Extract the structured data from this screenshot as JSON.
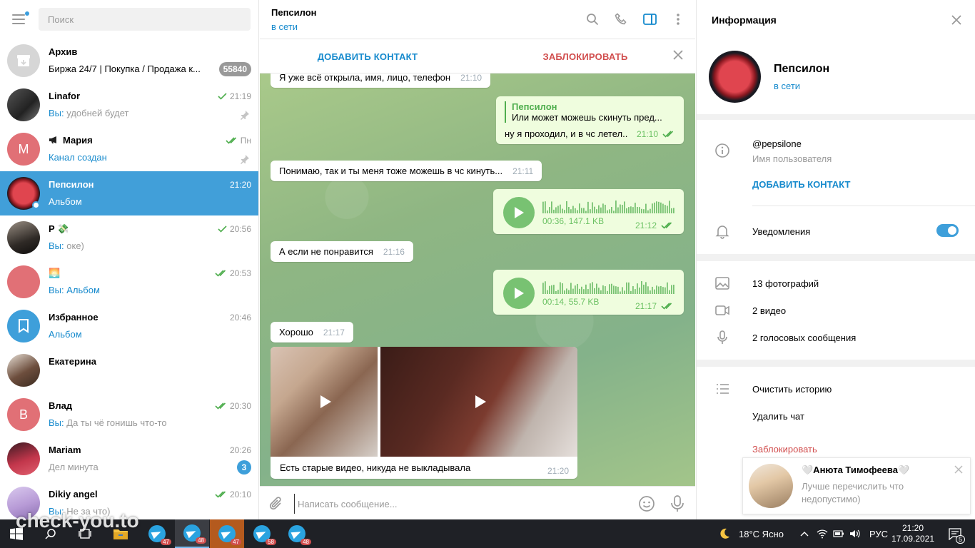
{
  "left": {
    "search_placeholder": "Поиск",
    "chats": [
      {
        "name": "Архив",
        "preview": "Биржа 24/7 | Покупка / Продажа к...",
        "badge": "55840"
      },
      {
        "name": "Linafor",
        "time": "21:19",
        "you": "Вы:",
        "preview": "удобней будет"
      },
      {
        "name": "Мария",
        "time": "Пн",
        "preview": "Канал создан",
        "initial": "М"
      },
      {
        "name": "Пепсилон",
        "time": "21:20",
        "preview": "Альбом"
      },
      {
        "name": "Р 💸",
        "time": "20:56",
        "you": "Вы:",
        "preview": "оке)"
      },
      {
        "name": "🌅",
        "time": "20:53",
        "you": "Вы:",
        "preview": "Альбом"
      },
      {
        "name": "Избранное",
        "time": "20:46",
        "preview": "Альбом"
      },
      {
        "name": "Екатерина",
        "time": "",
        "preview": ""
      },
      {
        "name": "Влад",
        "time": "20:30",
        "you": "Вы:",
        "preview": "Да ты чё гонишь что-то",
        "initial": "В"
      },
      {
        "name": "Mariam",
        "time": "20:26",
        "preview": "Дел минута",
        "badge": "3"
      },
      {
        "name": "Dikiy angel",
        "time": "20:10",
        "you": "Вы:",
        "preview": "Не за что)"
      }
    ]
  },
  "chat": {
    "peer_name": "Пепсилон",
    "peer_status": "в сети",
    "add_contact": "ДОБАВИТЬ КОНТАКТ",
    "block": "ЗАБЛОКИРОВАТЬ",
    "messages": [
      {
        "text": "Я уже всё открыла, имя, лицо, телефон",
        "time": "21:10"
      },
      {
        "reply_name": "Пепсилон",
        "reply_text": "Или может можешь скинуть пред...",
        "text": "ну я проходил, и в чс летел..",
        "time": "21:10"
      },
      {
        "text": "Понимаю, так и ты меня тоже можешь в чс кинуть...",
        "time": "21:11"
      },
      {
        "voice_info": "00:36, 147.1 KB",
        "time": "21:12"
      },
      {
        "text": "А если не понравится",
        "time": "21:16"
      },
      {
        "voice_info": "00:14, 55.7 KB",
        "time": "21:17"
      },
      {
        "text": "Хорошо",
        "time": "21:17"
      },
      {
        "caption": "Есть старые видео, никуда не выкладывала",
        "time": "21:20"
      }
    ],
    "composer_placeholder": "Написать сообщение..."
  },
  "info": {
    "title": "Информация",
    "name": "Пепсилон",
    "status": "в сети",
    "username": "@pepsilone",
    "username_label": "Имя пользователя",
    "add_contact": "ДОБАВИТЬ КОНТАКТ",
    "notifications": "Уведомления",
    "notifications_on": true,
    "photos": "13 фотографий",
    "videos": "2 видео",
    "voice": "2 голосовых сообщения",
    "clear_history": "Очистить историю",
    "delete_chat": "Удалить чат",
    "block": "Заблокировать"
  },
  "notification": {
    "name": "🤍Анюта Тимофеева🤍",
    "text": "Лучше перечислить что недопустимо)"
  },
  "taskbar": {
    "weather": "18°C  Ясно",
    "lang": "РУС",
    "time": "21:20",
    "date": "17.09.2021",
    "tg_badges": [
      "47",
      "48",
      "47",
      "58",
      "48"
    ],
    "notif_count": "5"
  },
  "watermark": "check-you.to",
  "colors": {
    "accent": "#419fd9",
    "link": "#168acd",
    "danger": "#d14e4e",
    "outgoing": "#effdde",
    "check_green": "#4fae4e"
  }
}
